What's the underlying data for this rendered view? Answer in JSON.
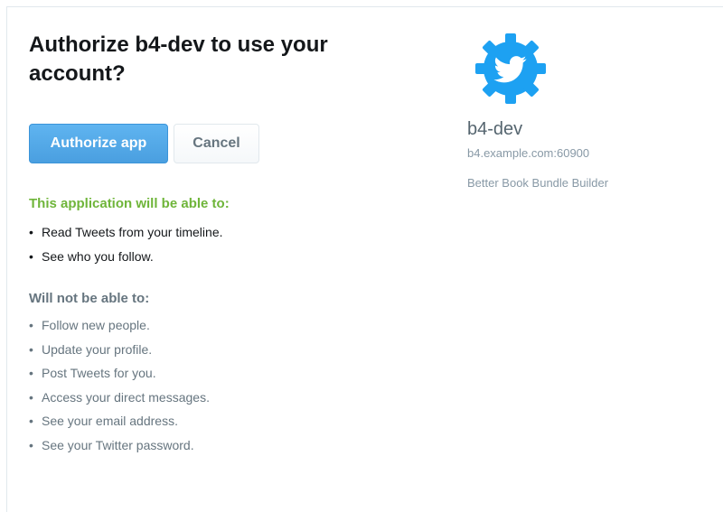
{
  "auth": {
    "title": "Authorize b4-dev to use your account?",
    "authorize_button": "Authorize app",
    "cancel_button": "Cancel"
  },
  "permissions": {
    "allowed_heading": "This application will be able to:",
    "allowed": [
      "Read Tweets from your timeline.",
      "See who you follow."
    ],
    "denied_heading": "Will not be able to:",
    "denied": [
      "Follow new people.",
      "Update your profile.",
      "Post Tweets for you.",
      "Access your direct messages.",
      "See your email address.",
      "See your Twitter password."
    ],
    "bullet": "•"
  },
  "app": {
    "logo_icon": "twitter-bird-gear-icon",
    "name": "b4-dev",
    "url": "b4.example.com:60900",
    "description": "Better Book Bundle Builder"
  },
  "colors": {
    "primary": "#55acee",
    "allowed_heading": "#6fb53a",
    "muted_text": "#66757f",
    "logo": "#1da1f2"
  }
}
